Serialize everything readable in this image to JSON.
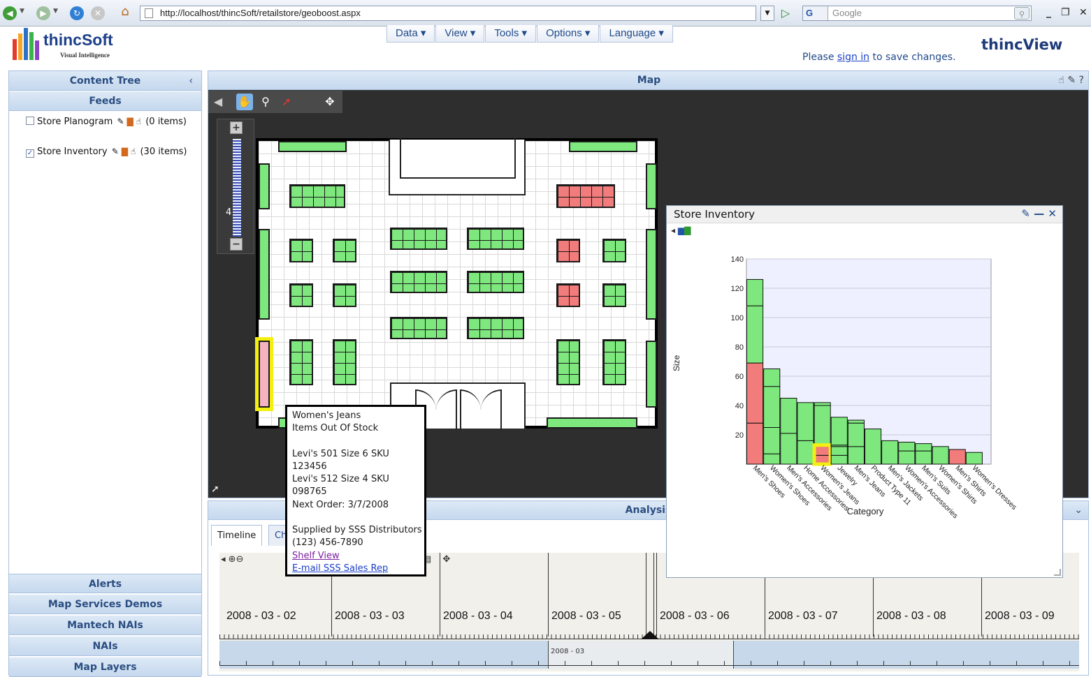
{
  "browser": {
    "url": "http://localhost/thincSoft/retailstore/geoboost.aspx",
    "search_engine": "G",
    "search_placeholder": "Google",
    "minimize": "_",
    "restore": "❐",
    "close": "✕"
  },
  "app": {
    "logo_name": "thincSoft",
    "logo_tag": "Visual Intelligence",
    "brand": "thincView",
    "signin_prefix": "Please ",
    "signin_link": "sign in",
    "signin_suffix": " to save changes.",
    "menu": [
      "Data ▾",
      "View ▾",
      "Tools ▾",
      "Options ▾",
      "Language ▾"
    ]
  },
  "left_panel": {
    "content_tree": "Content Tree",
    "collapse": "‹",
    "feeds": "Feeds",
    "feed_items": [
      {
        "label": "Store Planogram",
        "count": "(0 items)",
        "checked": false
      },
      {
        "label": "Store Inventory",
        "count": "(30 items)",
        "checked": true
      }
    ],
    "bottom_sections": [
      "Alerts",
      "Map Services Demos",
      "Mantech NAIs",
      "NAIs",
      "Map Layers"
    ]
  },
  "map_panel": {
    "title": "Map",
    "header_tools": "☝ ✎ ?",
    "zoom_level": "4",
    "zoom_in": "+",
    "zoom_out": "−",
    "status_colors": {
      "in_stock": "#7ee87e",
      "out_of_stock": "#f27b7b",
      "selected_outline": "#f3ef10"
    }
  },
  "tooltip": {
    "category": "Women's Jeans",
    "status": "Items Out Of Stock",
    "item1_line1": "Levi's 501 Size 6 SKU",
    "item1_line2": "123456",
    "item2_line1": "Levi's 512 Size 4 SKU",
    "item2_line2": "098765",
    "next_order": "Next Order: 3/7/2008",
    "supplier": "Supplied by SSS Distributors",
    "phone": "(123) 456-7890",
    "shelf_view": "Shelf View",
    "email": "E-mail SSS Sales Rep"
  },
  "analysis": {
    "title": "Analysis",
    "collapse": "⌄",
    "tabs": [
      "Timeline",
      "Ch"
    ],
    "timeline_dates": [
      "2008 - 03 - 02",
      "2008 - 03 - 03",
      "2008 - 03 - 04",
      "2008 - 03 - 05",
      "2008 - 03 - 06",
      "2008 - 03 - 07",
      "2008 - 03 - 08",
      "2008 - 03 - 09"
    ],
    "overview_label": "2008 - 03"
  },
  "chart_window": {
    "title": "Store Inventory",
    "controls": "✎ — ✕"
  },
  "chart_data": {
    "type": "bar",
    "stacked": true,
    "title": "",
    "xlabel": "Category",
    "ylabel": "Size",
    "ylim": [
      0,
      140
    ],
    "yticks": [
      20,
      40,
      60,
      80,
      100,
      120,
      140
    ],
    "grid": true,
    "categories": [
      "Men's Shoes",
      "Women's Shoes",
      "Men's Accessories",
      "Home Accessories",
      "Women's Jeans",
      "Jewelry",
      "Men's Jeans",
      "Product Type 11",
      "Men's Jackets",
      "Women's Accessories",
      "Men's Suits",
      "Women's Shirts",
      "Men's Shirts",
      "Women's Dresses"
    ],
    "segments": [
      [
        {
          "v": 28,
          "c": "red"
        },
        {
          "v": 41,
          "c": "red"
        },
        {
          "v": 39,
          "c": "green"
        },
        {
          "v": 18,
          "c": "green"
        }
      ],
      [
        {
          "v": 7,
          "c": "green"
        },
        {
          "v": 18,
          "c": "green"
        },
        {
          "v": 28,
          "c": "green"
        },
        {
          "v": 12,
          "c": "green"
        }
      ],
      [
        {
          "v": 21,
          "c": "green"
        },
        {
          "v": 24,
          "c": "green"
        }
      ],
      [
        {
          "v": 16,
          "c": "green"
        },
        {
          "v": 26,
          "c": "green"
        }
      ],
      [
        {
          "v": 6,
          "c": "red"
        },
        {
          "v": 7,
          "c": "red"
        },
        {
          "v": 27,
          "c": "green"
        },
        {
          "v": 2,
          "c": "green"
        }
      ],
      [
        {
          "v": 6,
          "c": "green"
        },
        {
          "v": 6,
          "c": "green"
        },
        {
          "v": 1,
          "c": "green"
        },
        {
          "v": 19,
          "c": "green"
        }
      ],
      [
        {
          "v": 12,
          "c": "green"
        },
        {
          "v": 16,
          "c": "green"
        },
        {
          "v": 2,
          "c": "green"
        }
      ],
      [
        {
          "v": 24,
          "c": "green"
        }
      ],
      [
        {
          "v": 16,
          "c": "green"
        }
      ],
      [
        {
          "v": 9,
          "c": "green"
        },
        {
          "v": 6,
          "c": "green"
        }
      ],
      [
        {
          "v": 9,
          "c": "green"
        },
        {
          "v": 5,
          "c": "green"
        }
      ],
      [
        {
          "v": 12,
          "c": "green"
        }
      ],
      [
        {
          "v": 10,
          "c": "red"
        }
      ],
      [
        {
          "v": 8,
          "c": "green"
        }
      ]
    ],
    "highlighted_category": "Women's Jeans",
    "colors": {
      "green": "#7ee87e",
      "red": "#f27b7b",
      "highlight": "#f3ef10",
      "plot_bg": "#eef0ff"
    }
  }
}
